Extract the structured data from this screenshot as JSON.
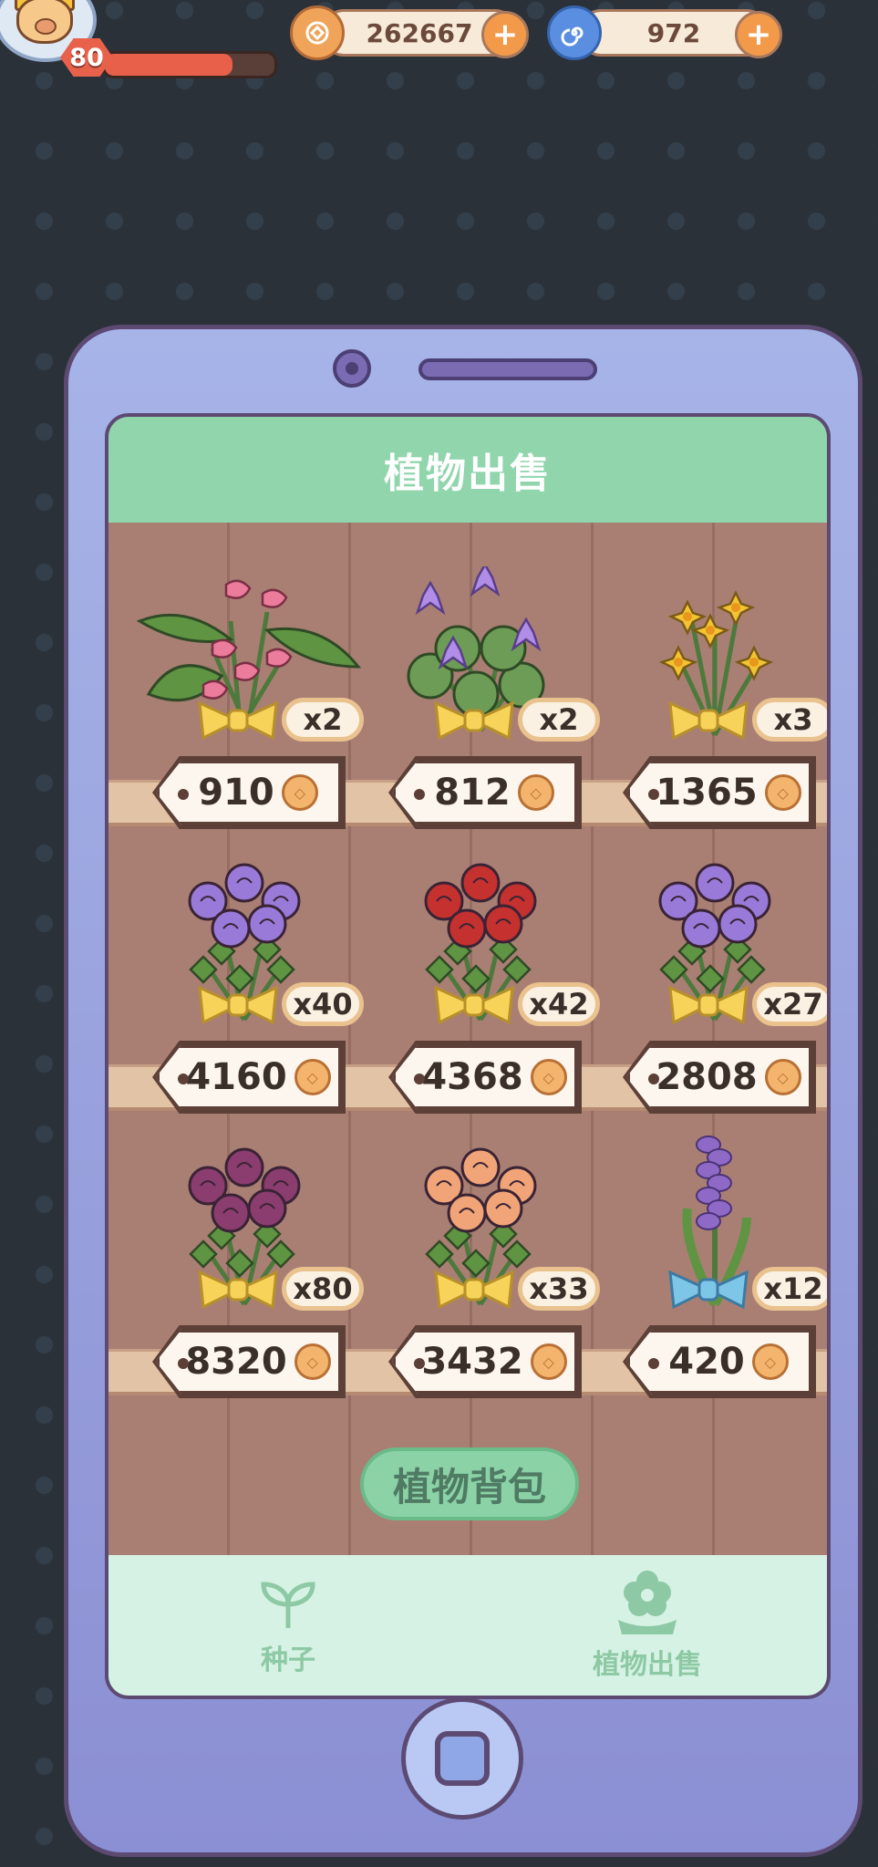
{
  "hud": {
    "level": "80",
    "xp_fraction": 0.75,
    "coins": "262667",
    "gems": "972"
  },
  "screen": {
    "title": "植物出售",
    "bag_button": "植物背包",
    "tabs": [
      {
        "label": "种子",
        "icon": "sprout-icon"
      },
      {
        "label": "植物出售",
        "icon": "flower-icon"
      }
    ],
    "plants": [
      {
        "qty": "x2",
        "price": "910",
        "flower": "anthurium",
        "color": "#ec7c9b"
      },
      {
        "qty": "x2",
        "price": "812",
        "flower": "water-lily",
        "color": "#b08de6"
      },
      {
        "qty": "x3",
        "price": "1365",
        "flower": "daffodil",
        "color": "#f2c332"
      },
      {
        "qty": "x40",
        "price": "4160",
        "flower": "rose",
        "color": "#9a7ad9"
      },
      {
        "qty": "x42",
        "price": "4368",
        "flower": "rose",
        "color": "#c4312f"
      },
      {
        "qty": "x27",
        "price": "2808",
        "flower": "rose",
        "color": "#9a7ad9"
      },
      {
        "qty": "x80",
        "price": "8320",
        "flower": "rose",
        "color": "#8a3d6e"
      },
      {
        "qty": "x33",
        "price": "3432",
        "flower": "rose",
        "color": "#f0a477"
      },
      {
        "qty": "x12",
        "price": "420",
        "flower": "hyacinth",
        "color": "#8e6ac6"
      }
    ]
  }
}
